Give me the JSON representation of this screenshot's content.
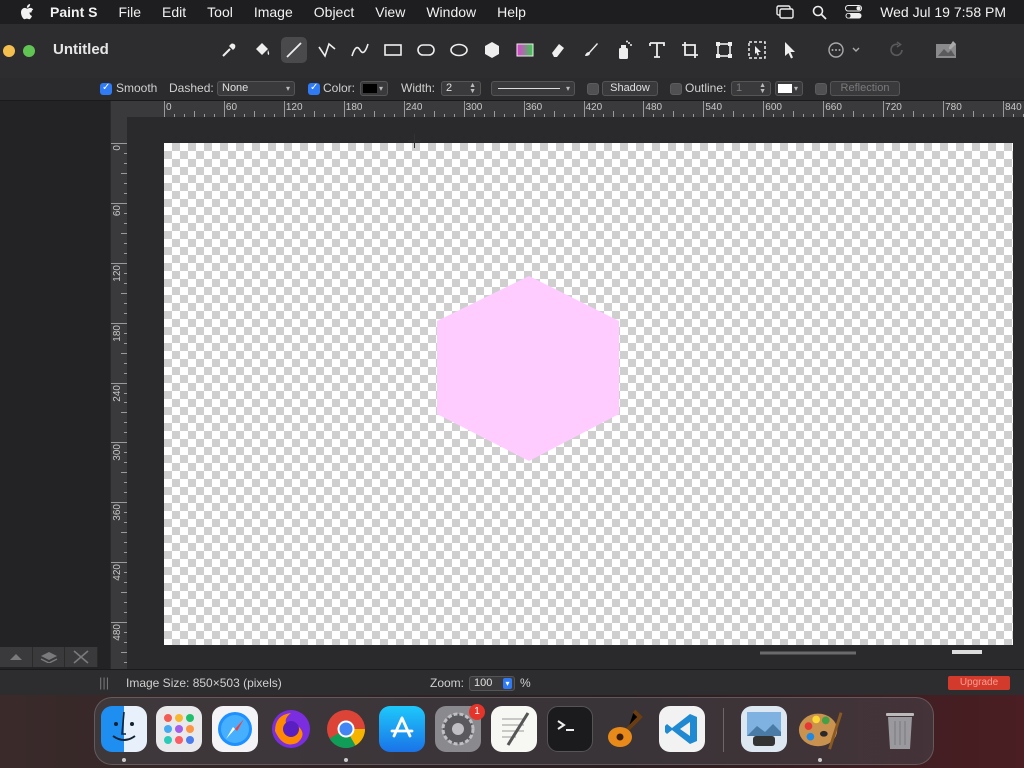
{
  "menubar": {
    "app_name": "Paint S",
    "items": [
      "File",
      "Edit",
      "Tool",
      "Image",
      "Object",
      "View",
      "Window",
      "Help"
    ],
    "clock": "Wed Jul 19  7:58 PM"
  },
  "window": {
    "title": "Untitled"
  },
  "options": {
    "smooth_label": "Smooth",
    "smooth_checked": true,
    "dashed_label": "Dashed:",
    "dashed_value": "None",
    "color_label": "Color:",
    "color_checked": true,
    "color_value": "#000000",
    "width_label": "Width:",
    "width_value": "2",
    "shadow_label": "Shadow",
    "outline_label": "Outline:",
    "outline_value": "1",
    "outline_color": "#ffffff",
    "reflection_label": "Reflection"
  },
  "rulers": {
    "h_ticks": [
      "0",
      "60",
      "120",
      "180",
      "240",
      "300",
      "360",
      "420",
      "480",
      "540",
      "600",
      "660",
      "720",
      "780",
      "840"
    ],
    "v_ticks": [
      "0",
      "60",
      "120",
      "180",
      "240",
      "300",
      "360",
      "420",
      "480"
    ]
  },
  "canvas": {
    "shape_color": "#ffccff"
  },
  "status": {
    "image_size": "Image Size: 850×503 (pixels)",
    "zoom_label": "Zoom:",
    "zoom_value": "100",
    "zoom_unit": "%",
    "upgrade_label": "Upgrade"
  },
  "dock": {
    "apps": [
      "finder-icon",
      "launchpad-icon",
      "safari-icon",
      "firefox-icon",
      "chrome-icon",
      "app-store-icon",
      "system-settings-icon",
      "textedit-icon",
      "terminal-icon",
      "garageband-icon",
      "vscode-icon",
      "preview-icon",
      "paint-s-icon",
      "trash-icon"
    ],
    "settings_badge": "1"
  }
}
